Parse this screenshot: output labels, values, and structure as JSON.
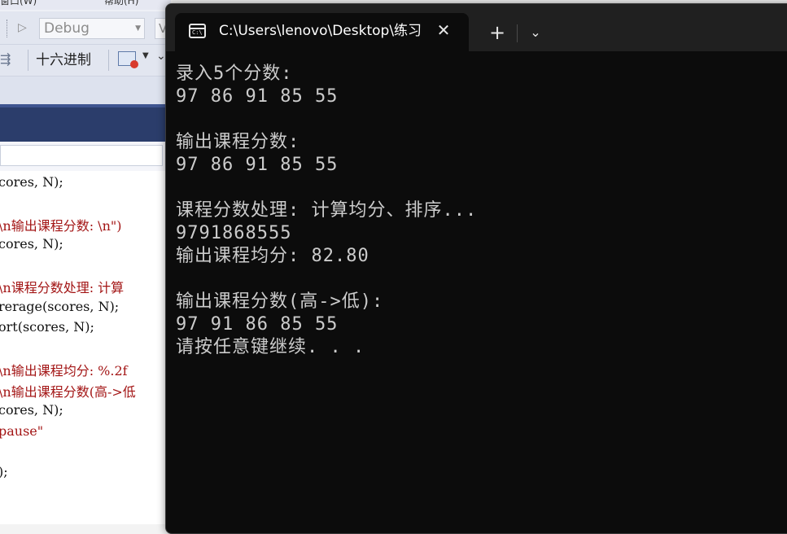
{
  "ide": {
    "menu": {
      "items": [
        "窗口(W)",
        "帮助(H)"
      ]
    },
    "toolbar": {
      "configuration": "Debug",
      "platform": "V",
      "hex_label": "十六进制"
    },
    "code_lines": [
      "cores, N);",
      "\\n输出课程分数: \\n\")",
      "cores, N);",
      "\\n课程分数处理: 计算",
      "rerage(scores, N);",
      "ort(scores, N);",
      "\\n输出课程均分: %.2f",
      "\\n输出课程分数(高->低",
      "cores, N);",
      "pause\"",
      ");"
    ]
  },
  "terminal": {
    "tab_title": "C:\\Users\\lenovo\\Desktop\\练习",
    "icon_glyph": "C:\\",
    "close_glyph": "✕",
    "new_tab_glyph": "+",
    "dropdown_glyph": "⌄",
    "lines": [
      "录入5个分数:",
      "97 86 91 85 55",
      "",
      "输出课程分数:",
      "97 86 91 85 55",
      "",
      "课程分数处理: 计算均分、排序...",
      "9791868555",
      "输出课程均分: 82.80",
      "",
      "输出课程分数(高->低):",
      "97 91 86 85 55",
      "请按任意键继续. . ."
    ]
  },
  "colors": {
    "terminal_bg": "#0c0c0c",
    "terminal_text": "#cccccc",
    "ide_tab_band": "#2b3d6b",
    "string_red": "#a31515"
  }
}
